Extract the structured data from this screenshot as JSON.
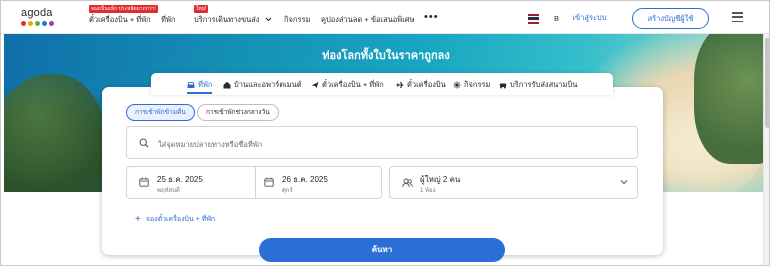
{
  "brand": {
    "name": "agoda",
    "dot_colors": [
      "#e12d2d",
      "#f4a300",
      "#4cb748",
      "#2b6fd6",
      "#8e44ad"
    ]
  },
  "nav": {
    "promo_badge": "จองเป็นแพ็ก ประหยัดมากกว่า!",
    "flight_hotel": "ตั๋วเครื่องบิน + ที่พัก",
    "hotels": "ที่พัก",
    "new_badge": "ใหม่!",
    "transport": "บริการเดินทางขนส่ง",
    "activities": "กิจกรรม",
    "deals": "คูปองส่วนลด + ข้อเสนอพิเศษ",
    "more": "•••",
    "currency": "B",
    "login": "เข้าสู่ระบบ",
    "signup": "สร้างบัญชีผู้ใช้"
  },
  "hero": {
    "title": "ท่องโลกทั้งใบในราคาถูกลง"
  },
  "tabs": [
    {
      "label": "ที่พัก",
      "icon": "hotel-icon",
      "active": true
    },
    {
      "label": "บ้านและอพาร์ตเมนต์",
      "icon": "home-icon",
      "active": false
    },
    {
      "label": "ตั๋วเครื่องบิน + ที่พัก",
      "icon": "flight-hotel-icon",
      "active": false
    },
    {
      "label": "ตั๋วเครื่องบิน",
      "icon": "plane-icon",
      "active": false
    },
    {
      "label": "กิจกรรม",
      "icon": "activity-icon",
      "active": false
    },
    {
      "label": "บริการรับส่งสนามบิน",
      "icon": "car-icon",
      "active": false
    }
  ],
  "search": {
    "stay_type_overnight": "การเข้าพักข้ามคืน",
    "stay_type_dayuse": "การเข้าพักช่วงกลางวัน",
    "destination_placeholder": "ใส่จุดหมายปลายทางหรือชื่อที่พัก",
    "checkin_date": "25 ธ.ค. 2025",
    "checkin_day": "พฤหัสบดี",
    "checkout_date": "26 ธ.ค. 2025",
    "checkout_day": "ศุกร์",
    "guests": "ผู้ใหญ่ 2 คน",
    "rooms": "1 ห้อง",
    "add_flight": "จองตั๋วเครื่องบิน + ที่พัก",
    "search_button": "ค้นหา"
  },
  "colors": {
    "accent": "#2b6fd6",
    "badge_red": "#e12d2d"
  }
}
